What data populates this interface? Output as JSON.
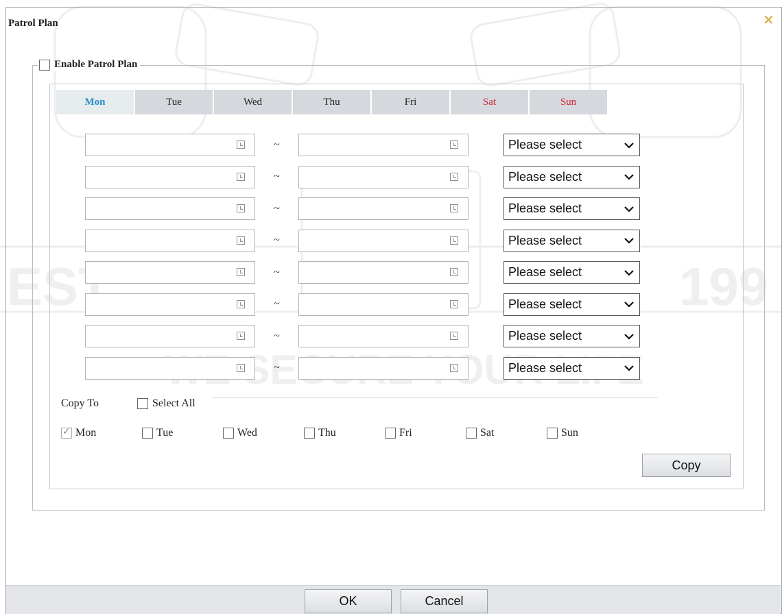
{
  "dialog": {
    "title": "Patrol Plan"
  },
  "enable": {
    "label": "Enable Patrol Plan",
    "checked": false
  },
  "tabs": [
    {
      "label": "Mon",
      "active": true,
      "weekend": false
    },
    {
      "label": "Tue",
      "active": false,
      "weekend": false
    },
    {
      "label": "Wed",
      "active": false,
      "weekend": false
    },
    {
      "label": "Thu",
      "active": false,
      "weekend": false
    },
    {
      "label": "Fri",
      "active": false,
      "weekend": false
    },
    {
      "label": "Sat",
      "active": false,
      "weekend": true
    },
    {
      "label": "Sun",
      "active": false,
      "weekend": true
    }
  ],
  "schedule": {
    "separator": "~",
    "rows": [
      {
        "start": "",
        "end": "",
        "preset": "Please select"
      },
      {
        "start": "",
        "end": "",
        "preset": "Please select"
      },
      {
        "start": "",
        "end": "",
        "preset": "Please select"
      },
      {
        "start": "",
        "end": "",
        "preset": "Please select"
      },
      {
        "start": "",
        "end": "",
        "preset": "Please select"
      },
      {
        "start": "",
        "end": "",
        "preset": "Please select"
      },
      {
        "start": "",
        "end": "",
        "preset": "Please select"
      },
      {
        "start": "",
        "end": "",
        "preset": "Please select"
      }
    ]
  },
  "copy": {
    "label": "Copy To",
    "select_all": "Select All",
    "days": [
      {
        "label": "Mon",
        "checked": true
      },
      {
        "label": "Tue",
        "checked": false
      },
      {
        "label": "Wed",
        "checked": false
      },
      {
        "label": "Thu",
        "checked": false
      },
      {
        "label": "Fri",
        "checked": false
      },
      {
        "label": "Sat",
        "checked": false
      },
      {
        "label": "Sun",
        "checked": false
      }
    ],
    "button": "Copy"
  },
  "footer": {
    "ok": "OK",
    "cancel": "Cancel"
  },
  "colors": {
    "active_tab_text": "#2a8fc7",
    "weekend_text": "#d2233a",
    "close_icon": "#d9a32a"
  }
}
